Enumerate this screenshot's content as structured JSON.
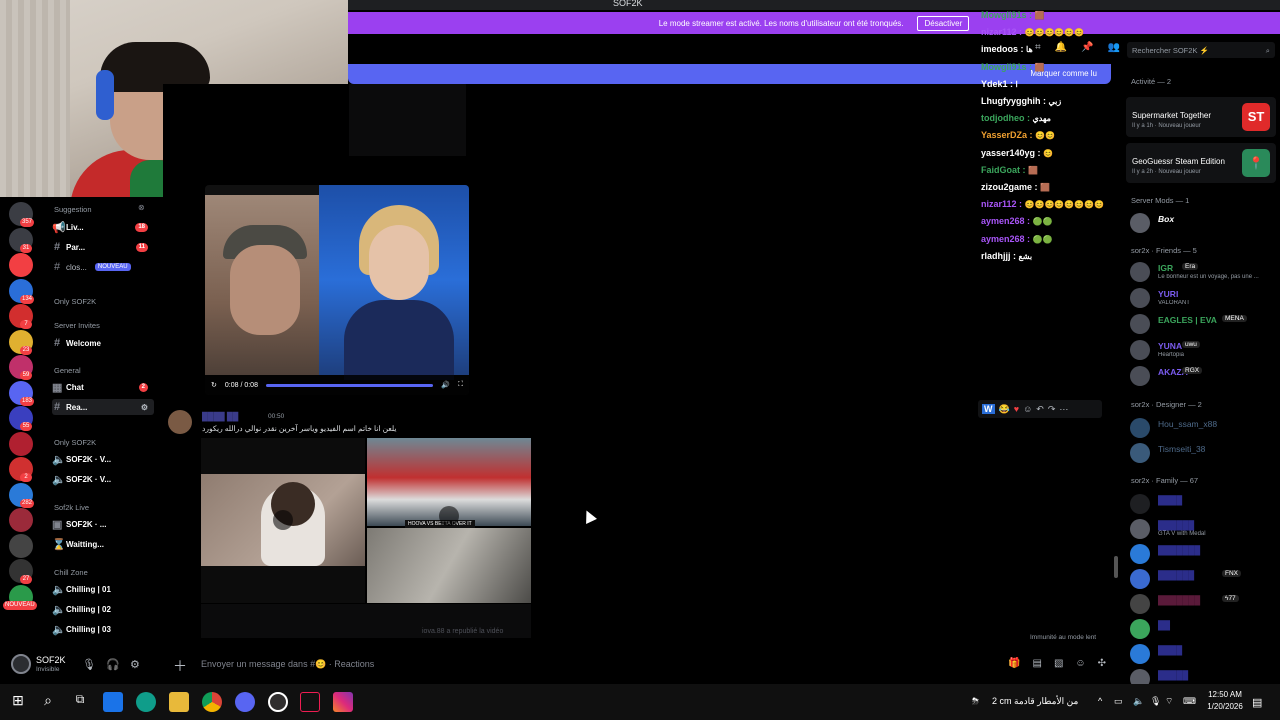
{
  "window": {
    "title": "SOF2K"
  },
  "banners": {
    "streamer_mode": "Le mode streamer est activé. Les noms d'utilisateur ont été tronqués.",
    "deactivate": "Désactiver",
    "mark_read": "Marquer comme lu"
  },
  "user": {
    "name": "SOF2K",
    "status": "Invisible"
  },
  "servers": [
    {
      "badge": "357",
      "color": "#3b3d44"
    },
    {
      "badge": "31",
      "color": "#3b3d44"
    },
    {
      "badge": "",
      "color": "#f23f43"
    },
    {
      "badge": "134",
      "color": "#2a6ed8"
    },
    {
      "badge": "7",
      "color": "#d22e2e"
    },
    {
      "badge": "23",
      "color": "#e0b030"
    },
    {
      "badge": "59",
      "color": "#c0306a"
    },
    {
      "badge": "183",
      "color": "#5865f2"
    },
    {
      "badge": "55",
      "color": "#3a3fbf"
    },
    {
      "badge": "",
      "color": "#b02030"
    },
    {
      "badge": "2",
      "color": "#d03030"
    },
    {
      "badge": "282",
      "color": "#2a7ad8"
    },
    {
      "badge": "",
      "color": "#9b2a3a"
    },
    {
      "badge": "",
      "color": "#444"
    },
    {
      "badge": "27",
      "color": "#333"
    },
    {
      "badge": "NOUVEAU",
      "color": "#2a9a4a"
    }
  ],
  "channels": {
    "suggestion": "Suggestion",
    "live": "Liv...",
    "live_count": "18",
    "par": "Par...",
    "par_count": "11",
    "clos": "clos...",
    "clos_badge": "NOUVEAU",
    "cat_only1": "Only SOF2K",
    "cat_invites": "Server Invites",
    "welcome": "Welcome",
    "cat_general": "General",
    "chat": "Chat",
    "chat_count": "2",
    "rea": "Rea...",
    "cat_only2": "Only SOF2K",
    "voice1": "SOF2K · V...",
    "voice2": "SOF2K · V...",
    "cat_live": "Sof2k Live",
    "live_voice": "SOF2K · ...",
    "waiting": "Waitting...",
    "cat_chill": "Chill Zone",
    "chill1": "Chilling | 01",
    "chill2": "Chilling | 02",
    "chill3": "Chilling | 03"
  },
  "video": {
    "time": "0:08 / 0:08"
  },
  "message": {
    "time": "00:50",
    "text": "يلعن انا خاتم اسم الفيديو وياسر آخرين نقدر نوالي درالله ريكورد"
  },
  "grid": {
    "tag": "HOOVA VS BETTA OVER IT",
    "caption": "iova.88 a republié la vidéo"
  },
  "slowmode": "Immunité au mode lent",
  "composer": {
    "placeholder": "Envoyer un message dans #😊 · Reactions"
  },
  "livechat": [
    {
      "user": "Mowgli91s",
      "msg": "🟫",
      "color": "#3ba55c"
    },
    {
      "user": "nizar112",
      "msg": "😊😊😊😊😊😊",
      "color": "#a855f7"
    },
    {
      "user": "imedoos",
      "msg": "ها",
      "color": "#ffffff"
    },
    {
      "user": "Mowgli91s",
      "msg": "🟫",
      "color": "#3ba55c"
    },
    {
      "user": "Ydek1",
      "msg": "ا",
      "color": "#ffffff"
    },
    {
      "user": "Lhugfyygghih",
      "msg": "زبي",
      "color": "#ffffff"
    },
    {
      "user": "todjodheo",
      "msg": "مهدي",
      "color": "#3ba55c"
    },
    {
      "user": "YasserDZa",
      "msg": "😊😊",
      "color": "#f0a030"
    },
    {
      "user": "yasser140yg",
      "msg": "😊",
      "color": "#ffffff"
    },
    {
      "user": "FaidGoat",
      "msg": "🟫",
      "color": "#3ba55c"
    },
    {
      "user": "zizou2game",
      "msg": "🟫",
      "color": "#ffffff"
    },
    {
      "user": "nizar112",
      "msg": "😊😊😊😊😊😊😊😊",
      "color": "#a855f7"
    },
    {
      "user": "aymen268",
      "msg": "🟢🟢",
      "color": "#a855f7"
    },
    {
      "user": "aymen268",
      "msg": "🟢🟢",
      "color": "#a855f7"
    },
    {
      "user": "rladhjjj",
      "msg": "بشع",
      "color": "#ffffff"
    }
  ],
  "members": {
    "search": "Rechercher SOF2K ⚡",
    "activity_header": "Activité — 2",
    "activities": [
      {
        "title": "Supermarket Together",
        "sub": "Il y a 1h  ·  Nouveau joueur",
        "logo": "ST",
        "color": "#e02a2a"
      },
      {
        "title": "GeoGuessr Steam Edition",
        "sub": "Il y a 2h  ·  Nouveau joueur",
        "logo": "📍",
        "color": "#2a8a5a"
      }
    ],
    "mods_header": "Server Mods — 1",
    "mod": "Box",
    "friends_header": "sor2x · Friends — 5",
    "friends": [
      {
        "name": "IGR",
        "sub": "Le bonheur est un voyage, pas une ...",
        "color": "#3ba55c",
        "badge": "Era"
      },
      {
        "name": "YURI",
        "sub": "VALORANT",
        "color": "#7b5cf0",
        "badge": ""
      },
      {
        "name": "EAGLES | EVA",
        "sub": "",
        "color": "#3ba55c",
        "badge": "MENA"
      },
      {
        "name": "YUNA",
        "sub": "Heartopia",
        "color": "#7b5cf0",
        "badge": "uwu"
      },
      {
        "name": "AKAZA",
        "sub": "",
        "color": "#7b5cf0",
        "badge": "RGX"
      }
    ],
    "designer_header": "sor2x · Designer — 2",
    "designers": [
      "Hou_ssam_x88",
      "Tismseiti_38"
    ],
    "family_header": "sor2x · Family — 67",
    "family_sub": "GTA V with Medal",
    "family_badge1": "FNX",
    "family_badge2": "ϟ77"
  },
  "taskbar": {
    "weather": "2 cm  من الأمطار قادمة",
    "time": "12:50 AM",
    "date": "1/20/2026"
  }
}
